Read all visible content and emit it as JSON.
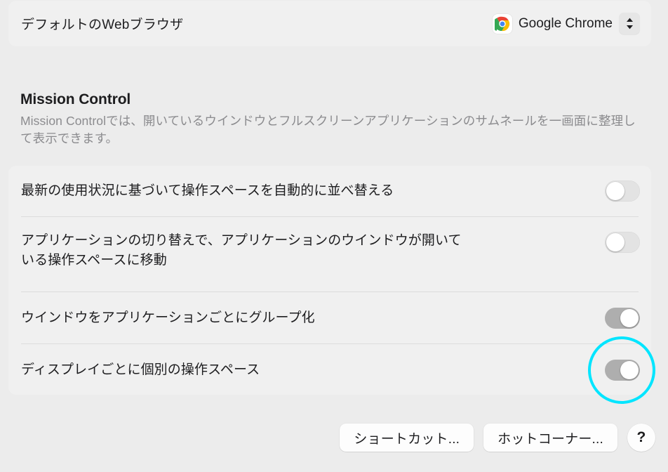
{
  "default_browser": {
    "label": "デフォルトのWebブラウザ",
    "selected_app": "Google Chrome",
    "app_icon": "chrome-icon",
    "popup_icon": "chevron-up-down-icon"
  },
  "mission_control": {
    "heading": "Mission Control",
    "description": "Mission Controlでは、開いているウインドウとフルスクリーンアプリケーションのサムネールを一画面に整理して表示できます。",
    "rows": [
      {
        "label_line1": "最新の使用状況に基づいて操作スペースを自動的に並べ替える",
        "label_line2": "",
        "toggle_state": "off",
        "name": "auto-rearrange-spaces"
      },
      {
        "label_line1": "アプリケーションの切り替えで、アプリケーションのウインドウが開いて",
        "label_line2": "いる操作スペースに移動",
        "toggle_state": "off",
        "name": "switch-to-space-with-open-windows"
      },
      {
        "label_line1": "ウインドウをアプリケーションごとにグループ化",
        "label_line2": "",
        "toggle_state": "on",
        "name": "group-windows-by-application"
      },
      {
        "label_line1": "ディスプレイごとに個別の操作スペース",
        "label_line2": "",
        "toggle_state": "on",
        "name": "displays-have-separate-spaces"
      }
    ]
  },
  "buttons": {
    "shortcuts": "ショートカット...",
    "hot_corners": "ホットコーナー...",
    "help": "?"
  },
  "annotation": {
    "type": "circle-highlight",
    "color": "#00e5ff",
    "target": "displays-have-separate-spaces-toggle"
  },
  "colors": {
    "page_background": "#ececec",
    "card_background": "#f0f0f0",
    "divider": "#dcdcdc",
    "primary_text": "#1d1d1f",
    "secondary_text": "#8b8b8e",
    "toggle_off_track": "#e3e3e3",
    "toggle_on_track": "#aeaeae",
    "highlight": "#00e5ff"
  }
}
